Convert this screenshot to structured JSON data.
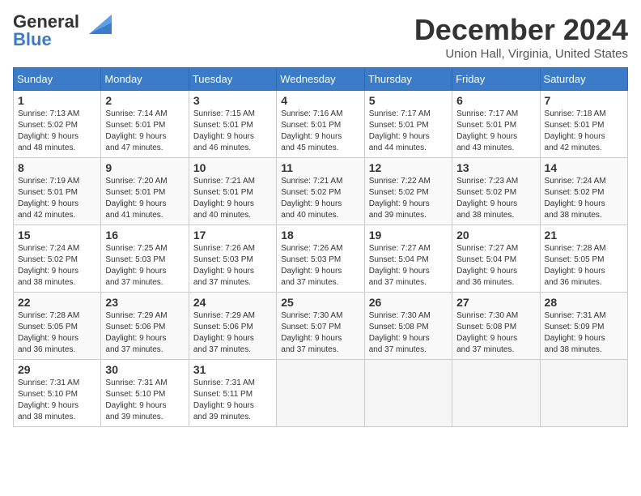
{
  "header": {
    "logo_general": "General",
    "logo_blue": "Blue",
    "month_title": "December 2024",
    "location": "Union Hall, Virginia, United States"
  },
  "days_of_week": [
    "Sunday",
    "Monday",
    "Tuesday",
    "Wednesday",
    "Thursday",
    "Friday",
    "Saturday"
  ],
  "weeks": [
    [
      {
        "day": 1,
        "info": "Sunrise: 7:13 AM\nSunset: 5:02 PM\nDaylight: 9 hours\nand 48 minutes."
      },
      {
        "day": 2,
        "info": "Sunrise: 7:14 AM\nSunset: 5:01 PM\nDaylight: 9 hours\nand 47 minutes."
      },
      {
        "day": 3,
        "info": "Sunrise: 7:15 AM\nSunset: 5:01 PM\nDaylight: 9 hours\nand 46 minutes."
      },
      {
        "day": 4,
        "info": "Sunrise: 7:16 AM\nSunset: 5:01 PM\nDaylight: 9 hours\nand 45 minutes."
      },
      {
        "day": 5,
        "info": "Sunrise: 7:17 AM\nSunset: 5:01 PM\nDaylight: 9 hours\nand 44 minutes."
      },
      {
        "day": 6,
        "info": "Sunrise: 7:17 AM\nSunset: 5:01 PM\nDaylight: 9 hours\nand 43 minutes."
      },
      {
        "day": 7,
        "info": "Sunrise: 7:18 AM\nSunset: 5:01 PM\nDaylight: 9 hours\nand 42 minutes."
      }
    ],
    [
      {
        "day": 8,
        "info": "Sunrise: 7:19 AM\nSunset: 5:01 PM\nDaylight: 9 hours\nand 42 minutes."
      },
      {
        "day": 9,
        "info": "Sunrise: 7:20 AM\nSunset: 5:01 PM\nDaylight: 9 hours\nand 41 minutes."
      },
      {
        "day": 10,
        "info": "Sunrise: 7:21 AM\nSunset: 5:01 PM\nDaylight: 9 hours\nand 40 minutes."
      },
      {
        "day": 11,
        "info": "Sunrise: 7:21 AM\nSunset: 5:02 PM\nDaylight: 9 hours\nand 40 minutes."
      },
      {
        "day": 12,
        "info": "Sunrise: 7:22 AM\nSunset: 5:02 PM\nDaylight: 9 hours\nand 39 minutes."
      },
      {
        "day": 13,
        "info": "Sunrise: 7:23 AM\nSunset: 5:02 PM\nDaylight: 9 hours\nand 38 minutes."
      },
      {
        "day": 14,
        "info": "Sunrise: 7:24 AM\nSunset: 5:02 PM\nDaylight: 9 hours\nand 38 minutes."
      }
    ],
    [
      {
        "day": 15,
        "info": "Sunrise: 7:24 AM\nSunset: 5:02 PM\nDaylight: 9 hours\nand 38 minutes."
      },
      {
        "day": 16,
        "info": "Sunrise: 7:25 AM\nSunset: 5:03 PM\nDaylight: 9 hours\nand 37 minutes."
      },
      {
        "day": 17,
        "info": "Sunrise: 7:26 AM\nSunset: 5:03 PM\nDaylight: 9 hours\nand 37 minutes."
      },
      {
        "day": 18,
        "info": "Sunrise: 7:26 AM\nSunset: 5:03 PM\nDaylight: 9 hours\nand 37 minutes."
      },
      {
        "day": 19,
        "info": "Sunrise: 7:27 AM\nSunset: 5:04 PM\nDaylight: 9 hours\nand 37 minutes."
      },
      {
        "day": 20,
        "info": "Sunrise: 7:27 AM\nSunset: 5:04 PM\nDaylight: 9 hours\nand 36 minutes."
      },
      {
        "day": 21,
        "info": "Sunrise: 7:28 AM\nSunset: 5:05 PM\nDaylight: 9 hours\nand 36 minutes."
      }
    ],
    [
      {
        "day": 22,
        "info": "Sunrise: 7:28 AM\nSunset: 5:05 PM\nDaylight: 9 hours\nand 36 minutes."
      },
      {
        "day": 23,
        "info": "Sunrise: 7:29 AM\nSunset: 5:06 PM\nDaylight: 9 hours\nand 37 minutes."
      },
      {
        "day": 24,
        "info": "Sunrise: 7:29 AM\nSunset: 5:06 PM\nDaylight: 9 hours\nand 37 minutes."
      },
      {
        "day": 25,
        "info": "Sunrise: 7:30 AM\nSunset: 5:07 PM\nDaylight: 9 hours\nand 37 minutes."
      },
      {
        "day": 26,
        "info": "Sunrise: 7:30 AM\nSunset: 5:08 PM\nDaylight: 9 hours\nand 37 minutes."
      },
      {
        "day": 27,
        "info": "Sunrise: 7:30 AM\nSunset: 5:08 PM\nDaylight: 9 hours\nand 37 minutes."
      },
      {
        "day": 28,
        "info": "Sunrise: 7:31 AM\nSunset: 5:09 PM\nDaylight: 9 hours\nand 38 minutes."
      }
    ],
    [
      {
        "day": 29,
        "info": "Sunrise: 7:31 AM\nSunset: 5:10 PM\nDaylight: 9 hours\nand 38 minutes."
      },
      {
        "day": 30,
        "info": "Sunrise: 7:31 AM\nSunset: 5:10 PM\nDaylight: 9 hours\nand 39 minutes."
      },
      {
        "day": 31,
        "info": "Sunrise: 7:31 AM\nSunset: 5:11 PM\nDaylight: 9 hours\nand 39 minutes."
      },
      null,
      null,
      null,
      null
    ]
  ]
}
